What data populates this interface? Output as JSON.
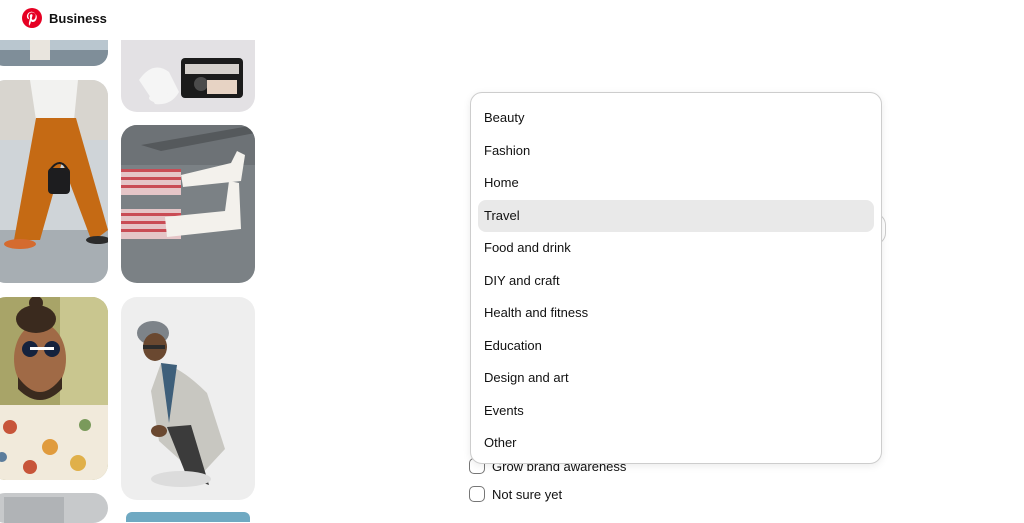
{
  "header": {
    "brand_label": "Business",
    "brand_color": "#e60023",
    "logo_icon": "pinterest-logo-icon"
  },
  "collage": {
    "tiles": [
      {
        "subject": "partial fashion photo"
      },
      {
        "subject": "sneakers and camera bag"
      },
      {
        "subject": "woman in orange trousers walking"
      },
      {
        "subject": "white boots on asphalt"
      },
      {
        "subject": "man with sunglasses and floral shirt"
      },
      {
        "subject": "man in beanie and grey coat"
      },
      {
        "subject": "partial photo"
      },
      {
        "subject": "partial photo"
      }
    ]
  },
  "dropdown": {
    "selected_index": 3,
    "options": [
      "Beauty",
      "Fashion",
      "Home",
      "Travel",
      "Food and drink",
      "DIY and craft",
      "Health and fitness",
      "Education",
      "Design and art",
      "Events",
      "Other"
    ]
  },
  "goals": {
    "options": [
      {
        "label": "Grow brand awareness",
        "checked": false
      },
      {
        "label": "Not sure yet",
        "checked": false
      }
    ]
  }
}
